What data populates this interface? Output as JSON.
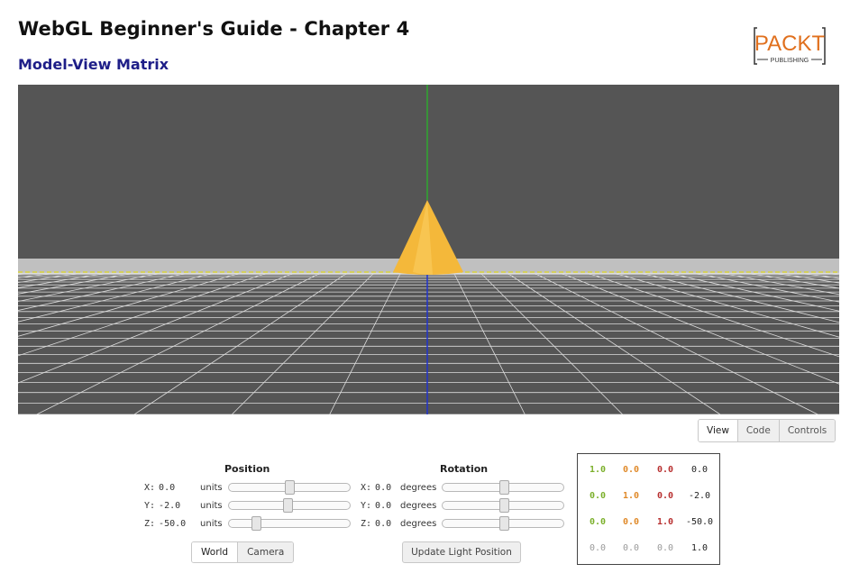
{
  "header": {
    "title": "WebGL Beginner's Guide - Chapter 4",
    "subtitle": "Model-View Matrix",
    "logo_text": "PACKT",
    "logo_sub": "PUBLISHING"
  },
  "tabs": [
    {
      "label": "View",
      "active": true
    },
    {
      "label": "Code",
      "active": false
    },
    {
      "label": "Controls",
      "active": false
    }
  ],
  "position": {
    "heading": "Position",
    "unit": "units",
    "rows": [
      {
        "axis": "X:",
        "value": "0.0",
        "fraction": 0.5
      },
      {
        "axis": "Y:",
        "value": "-2.0",
        "fraction": 0.48
      },
      {
        "axis": "Z:",
        "value": "-50.0",
        "fraction": 0.2
      }
    ]
  },
  "rotation": {
    "heading": "Rotation",
    "unit": "degrees",
    "rows": [
      {
        "axis": "X:",
        "value": "0.0",
        "fraction": 0.5
      },
      {
        "axis": "Y:",
        "value": "0.0",
        "fraction": 0.5
      },
      {
        "axis": "Z:",
        "value": "0.0",
        "fraction": 0.5
      }
    ]
  },
  "mode_buttons": [
    {
      "label": "World",
      "active": true
    },
    {
      "label": "Camera",
      "active": false
    }
  ],
  "light_button": "Update Light Position",
  "matrix": {
    "rows": [
      [
        "1.0",
        "0.0",
        "0.0",
        "0.0"
      ],
      [
        "0.0",
        "1.0",
        "0.0",
        "-2.0"
      ],
      [
        "0.0",
        "0.0",
        "1.0",
        "-50.0"
      ],
      [
        "0.0",
        "0.0",
        "0.0",
        "1.0"
      ]
    ],
    "colors": {
      "green": "#7cb02c",
      "orange": "#e08a2a",
      "red": "#b83030",
      "black": "#222222",
      "gray": "#9a9a9a"
    }
  },
  "scene": {
    "background": "#555555",
    "horizon_band": "#c0c0c0",
    "grid": "#dcdcdc",
    "cone": "#f4b83a",
    "y_axis": "#2fa82f",
    "z_axis": "#2233cc",
    "x_axis": "#d8d23c"
  }
}
